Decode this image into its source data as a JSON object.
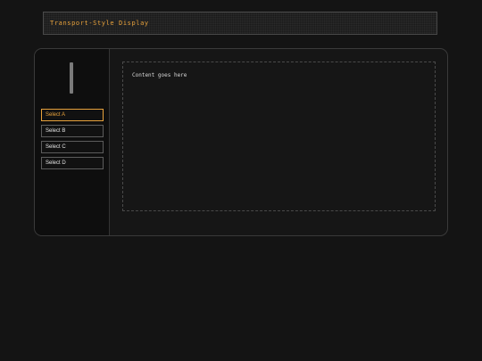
{
  "display": {
    "title": "Transport-Style Display"
  },
  "sidebar": {
    "handle_icon": "slider-handle",
    "buttons": [
      {
        "label": "Select A",
        "active": true
      },
      {
        "label": "Select B",
        "active": false
      },
      {
        "label": "Select C",
        "active": false
      },
      {
        "label": "Select D",
        "active": false
      }
    ]
  },
  "main": {
    "content_text": "Content goes here"
  },
  "colors": {
    "accent": "#e8a23c",
    "background": "#141414",
    "border": "#4a4a4a"
  }
}
